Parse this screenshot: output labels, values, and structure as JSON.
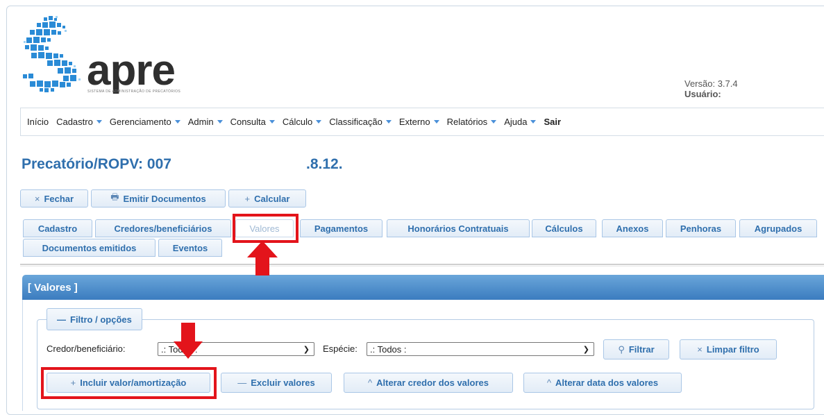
{
  "header": {
    "logo_word": "apre",
    "logo_sub": "SISTEMA DE ADMINISTRAÇÃO DE PRECATÓRIOS",
    "version": "Versão: 3.7.4",
    "user_label": "Usuário:"
  },
  "menu": [
    {
      "label": "Início",
      "caret": false
    },
    {
      "label": "Cadastro",
      "caret": true
    },
    {
      "label": "Gerenciamento",
      "caret": true
    },
    {
      "label": "Admin",
      "caret": true
    },
    {
      "label": "Consulta",
      "caret": true
    },
    {
      "label": "Cálculo",
      "caret": true
    },
    {
      "label": "Classificação",
      "caret": true
    },
    {
      "label": "Externo",
      "caret": true
    },
    {
      "label": "Relatórios",
      "caret": true
    },
    {
      "label": "Ajuda",
      "caret": true
    },
    {
      "label": "Sair",
      "caret": false
    }
  ],
  "title": {
    "main": "Precatório/ROPV: 007",
    "suffix": ".8.12."
  },
  "actions": {
    "close": "Fechar",
    "close_icon": "×",
    "emit": "Emitir Documentos",
    "emit_icon": "🖶",
    "calc": "Calcular",
    "calc_icon": "+"
  },
  "tabs": {
    "cadastro": "Cadastro",
    "credores": "Credores/beneficiários",
    "valores": "Valores",
    "pagamentos": "Pagamentos",
    "honorarios": "Honorários Contratuais",
    "calculos": "Cálculos",
    "anexos": "Anexos",
    "penhoras": "Penhoras",
    "agrupados": "Agrupados",
    "documentos": "Documentos emitidos",
    "eventos": "Eventos"
  },
  "panel": {
    "title": "[ Valores ]"
  },
  "filter": {
    "legend": "Filtro / opções",
    "credor_label": "Credor/beneficiário:",
    "credor_value": ".: Todos :",
    "especie_label": "Espécie:",
    "especie_value": ".: Todos :",
    "filtrar": "Filtrar",
    "limpar": "Limpar filtro"
  },
  "bottom_actions": {
    "incluir": "Incluir valor/amortização",
    "excluir": "Excluir valores",
    "alterar_credor": "Alterar credor dos valores",
    "alterar_data": "Alterar data dos valores"
  },
  "colors": {
    "accent": "#2f6fad",
    "annotation": "#e3141b"
  }
}
